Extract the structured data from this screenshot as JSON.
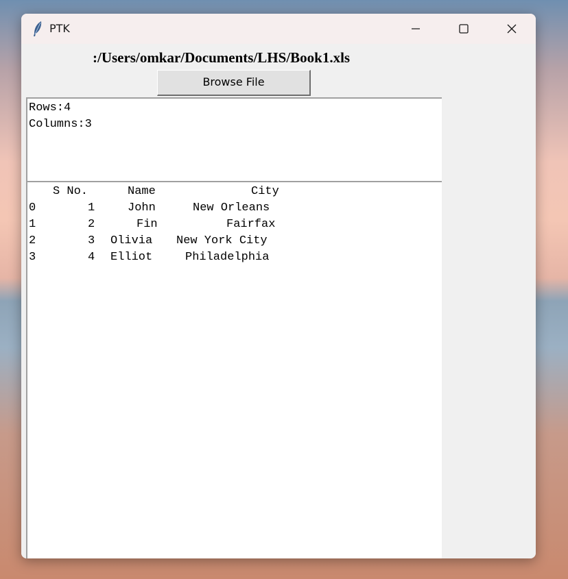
{
  "window": {
    "title": "PTK",
    "minimize_glyph": "—",
    "maximize_glyph": "☐",
    "close_glyph": "✕"
  },
  "file_path": ":/Users/omkar/Documents/LHS/Book1.xls",
  "browse_button": "Browse File",
  "info": {
    "rows": "Rows:4",
    "columns": "Columns:3"
  },
  "table": {
    "headers": [
      "S No.",
      "Name",
      "City"
    ],
    "rows": [
      [
        "0",
        "1",
        "John",
        "New Orleans"
      ],
      [
        "1",
        "2",
        "Fin",
        "Fairfax"
      ],
      [
        "2",
        "3",
        "Olivia",
        "New York City"
      ],
      [
        "3",
        "4",
        "Elliot",
        "Philadelphia"
      ]
    ]
  },
  "icons": {
    "app": "feather-icon",
    "minimize": "minimize-icon",
    "maximize": "maximize-icon",
    "close": "close-icon"
  }
}
